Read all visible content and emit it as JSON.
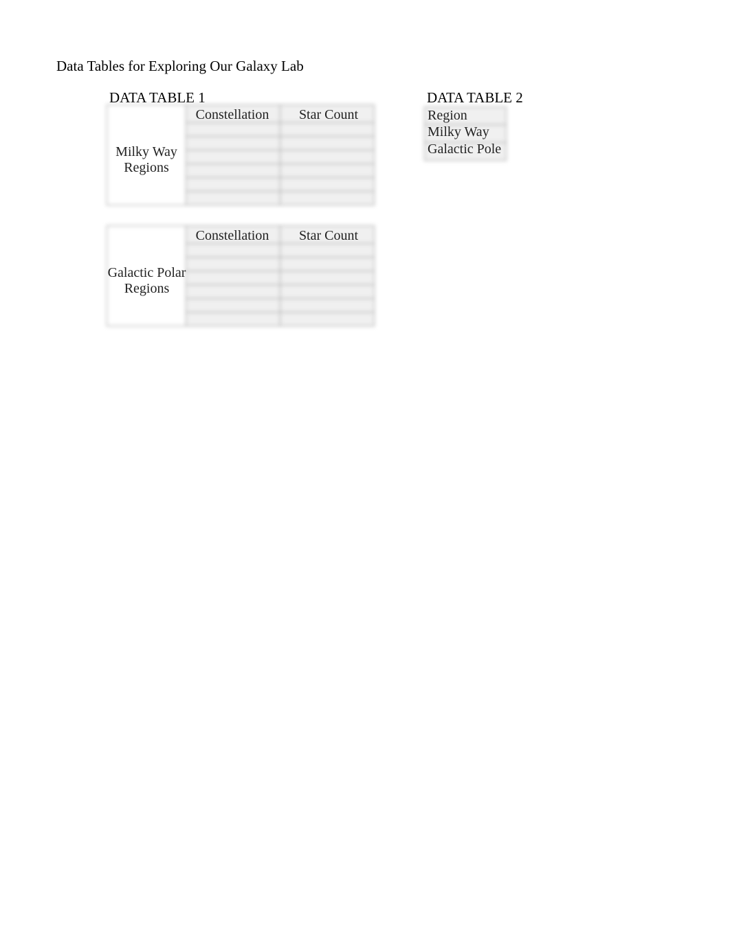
{
  "page": {
    "title": "Data Tables for Exploring Our Galaxy Lab"
  },
  "table1": {
    "label": "DATA TABLE 1",
    "section1": {
      "row_header": "Milky Way Regions",
      "col1": "Constellation",
      "col2": "Star Count"
    },
    "section2": {
      "row_header": "Galactic Polar Regions",
      "col1": "Constellation",
      "col2": "Star Count"
    }
  },
  "table2": {
    "label": "DATA TABLE 2",
    "rows": {
      "r1": "Region",
      "r2": "Milky Way",
      "r3": "Galactic Pole"
    }
  }
}
